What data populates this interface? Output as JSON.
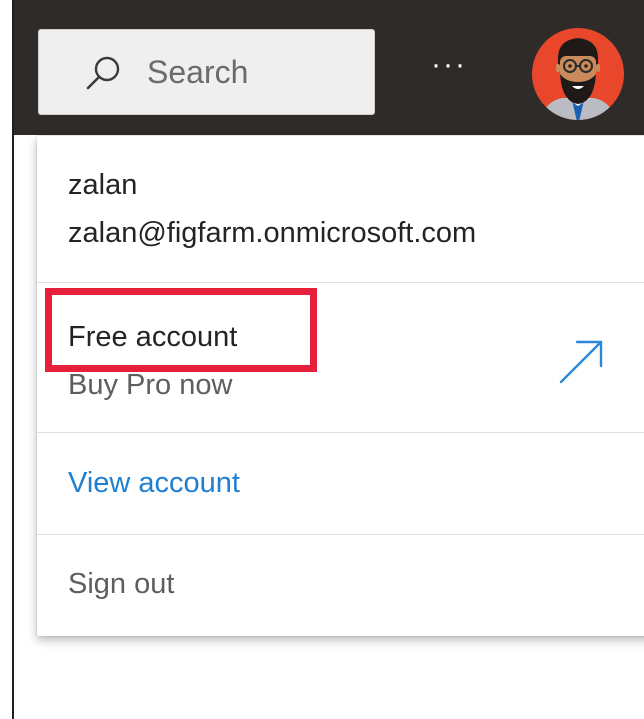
{
  "topbar": {
    "search_placeholder": "Search",
    "more_label": "···",
    "icons": {
      "search": "search-icon",
      "more": "more-options-icon",
      "avatar": "avatar"
    }
  },
  "account_menu": {
    "user_name": "zalan",
    "user_email": "zalan@figfarm.onmicrosoft.com",
    "account_type": "Free account",
    "upgrade_label": "Buy Pro now",
    "view_account_label": "View account",
    "sign_out_label": "Sign out",
    "icons": {
      "upgrade": "external-arrow-icon"
    }
  },
  "colors": {
    "topbar_bg": "#2f2b29",
    "link_blue": "#1f80d1",
    "highlight_red": "#e6203b",
    "avatar_bg": "#e8472b"
  }
}
